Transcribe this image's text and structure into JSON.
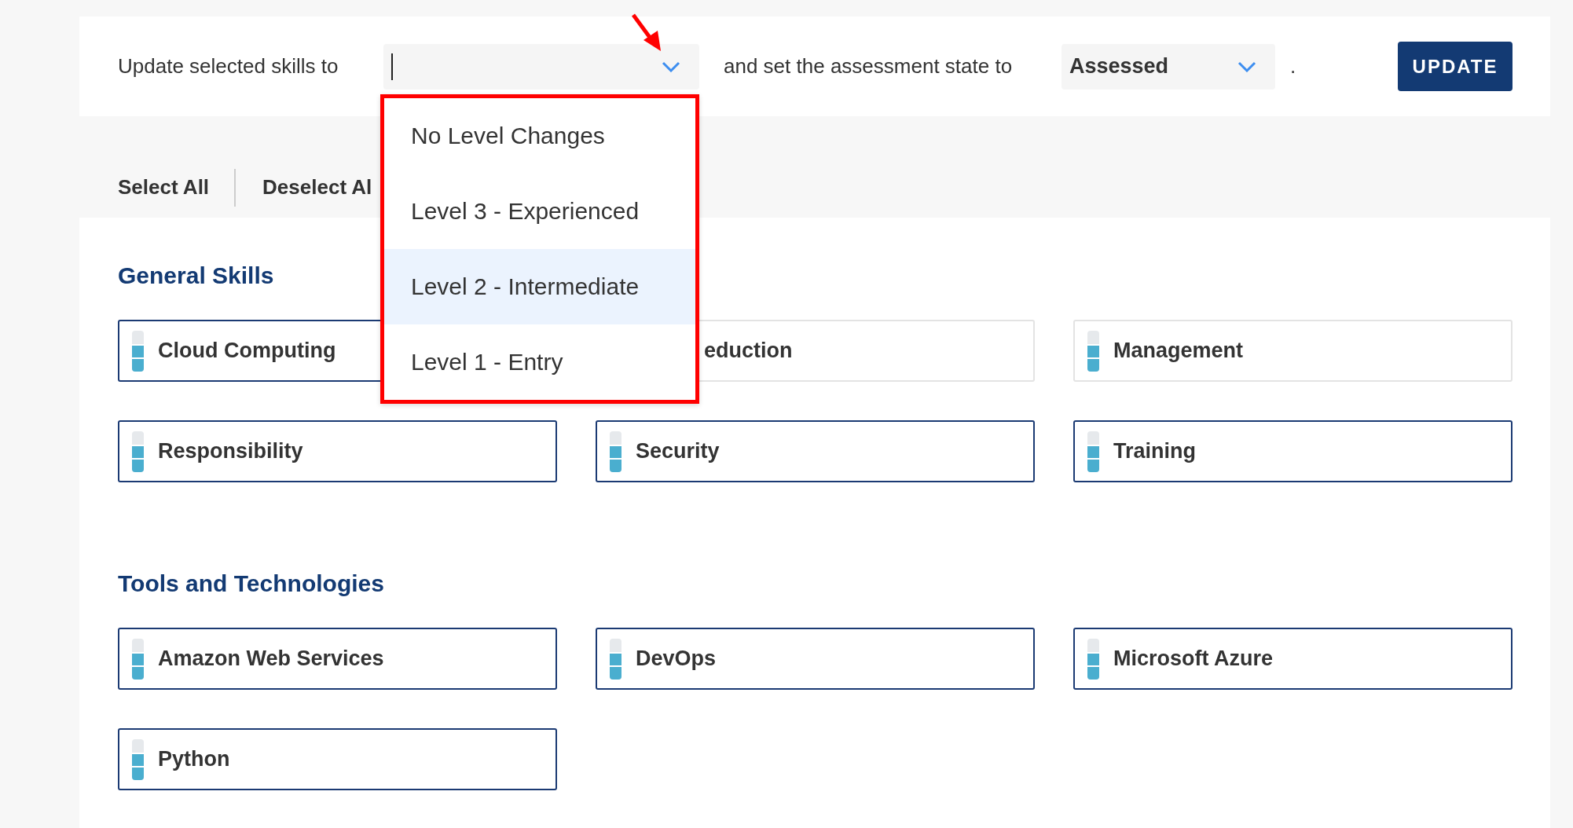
{
  "update_bar": {
    "label": "Update selected skills to",
    "level_select": {
      "expanded": true,
      "options": [
        {
          "label": "No Level Changes",
          "selected": false
        },
        {
          "label": "Level 3 - Experienced",
          "selected": false
        },
        {
          "label": "Level 2 - Intermediate",
          "selected": true
        },
        {
          "label": "Level 1 - Entry",
          "selected": false
        }
      ]
    },
    "state_label": "and set the assessment state to",
    "state_select": {
      "value": "Assessed"
    },
    "period": ".",
    "button": "UPDATE"
  },
  "selection_links": [
    "Select All",
    "Deselect Al"
  ],
  "sections": [
    {
      "title": "General Skills",
      "skills": [
        {
          "name": "Cloud Computing",
          "level": 0.67,
          "selected": true,
          "covered": false
        },
        {
          "name": "eduction",
          "selected": false,
          "covered": true
        },
        {
          "name": "Management",
          "level": 0.67,
          "selected": false,
          "covered": false
        },
        {
          "name": "Responsibility",
          "level": 0.67,
          "selected": true,
          "covered": false
        },
        {
          "name": "Security",
          "level": 0.67,
          "selected": true,
          "covered": false
        },
        {
          "name": "Training",
          "level": 0.67,
          "selected": true,
          "covered": false
        }
      ]
    },
    {
      "title": "Tools and Technologies",
      "skills": [
        {
          "name": "Amazon Web Services",
          "level": 0.67,
          "selected": true,
          "covered": false
        },
        {
          "name": "DevOps",
          "level": 0.67,
          "selected": true,
          "covered": false
        },
        {
          "name": "Microsoft Azure",
          "level": 0.67,
          "selected": true,
          "covered": false
        },
        {
          "name": "Python",
          "level": 0.67,
          "selected": true,
          "covered": false
        }
      ]
    }
  ],
  "markup": {
    "frame": true,
    "arrow": true
  }
}
